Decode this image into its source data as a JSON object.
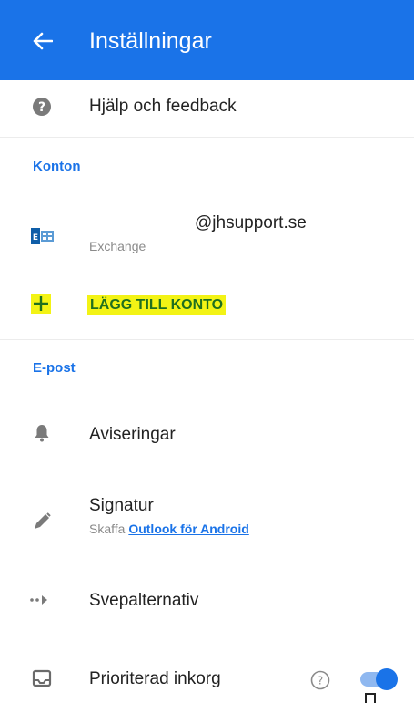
{
  "appbar": {
    "title": "Inställningar",
    "back_icon": "arrow-left-icon"
  },
  "help": {
    "label": "Hjälp och feedback",
    "icon": "help-circle-icon"
  },
  "accounts": {
    "section_title": "Konton",
    "items": [
      {
        "email_suffix": "@jhsupport.se",
        "type": "Exchange",
        "icon": "outlook-exchange-icon"
      }
    ],
    "add_label": "LÄGG TILL KONTO",
    "add_icon": "plus-icon"
  },
  "email": {
    "section_title": "E-post",
    "notifications": {
      "label": "Aviseringar",
      "icon": "bell-icon"
    },
    "signature": {
      "label": "Signatur",
      "sub_prefix": "Skaffa",
      "sub_link": "Outlook för Android",
      "icon": "pen-icon"
    },
    "swipe": {
      "label": "Svepalternativ",
      "icon": "swipe-arrow-icon"
    },
    "focused": {
      "label": "Prioriterad inkorg",
      "icon": "inbox-icon",
      "help_icon": "question-circle-icon",
      "toggle_on": true
    }
  },
  "colors": {
    "accent": "#1a73e8",
    "highlight": "#f3f315"
  }
}
